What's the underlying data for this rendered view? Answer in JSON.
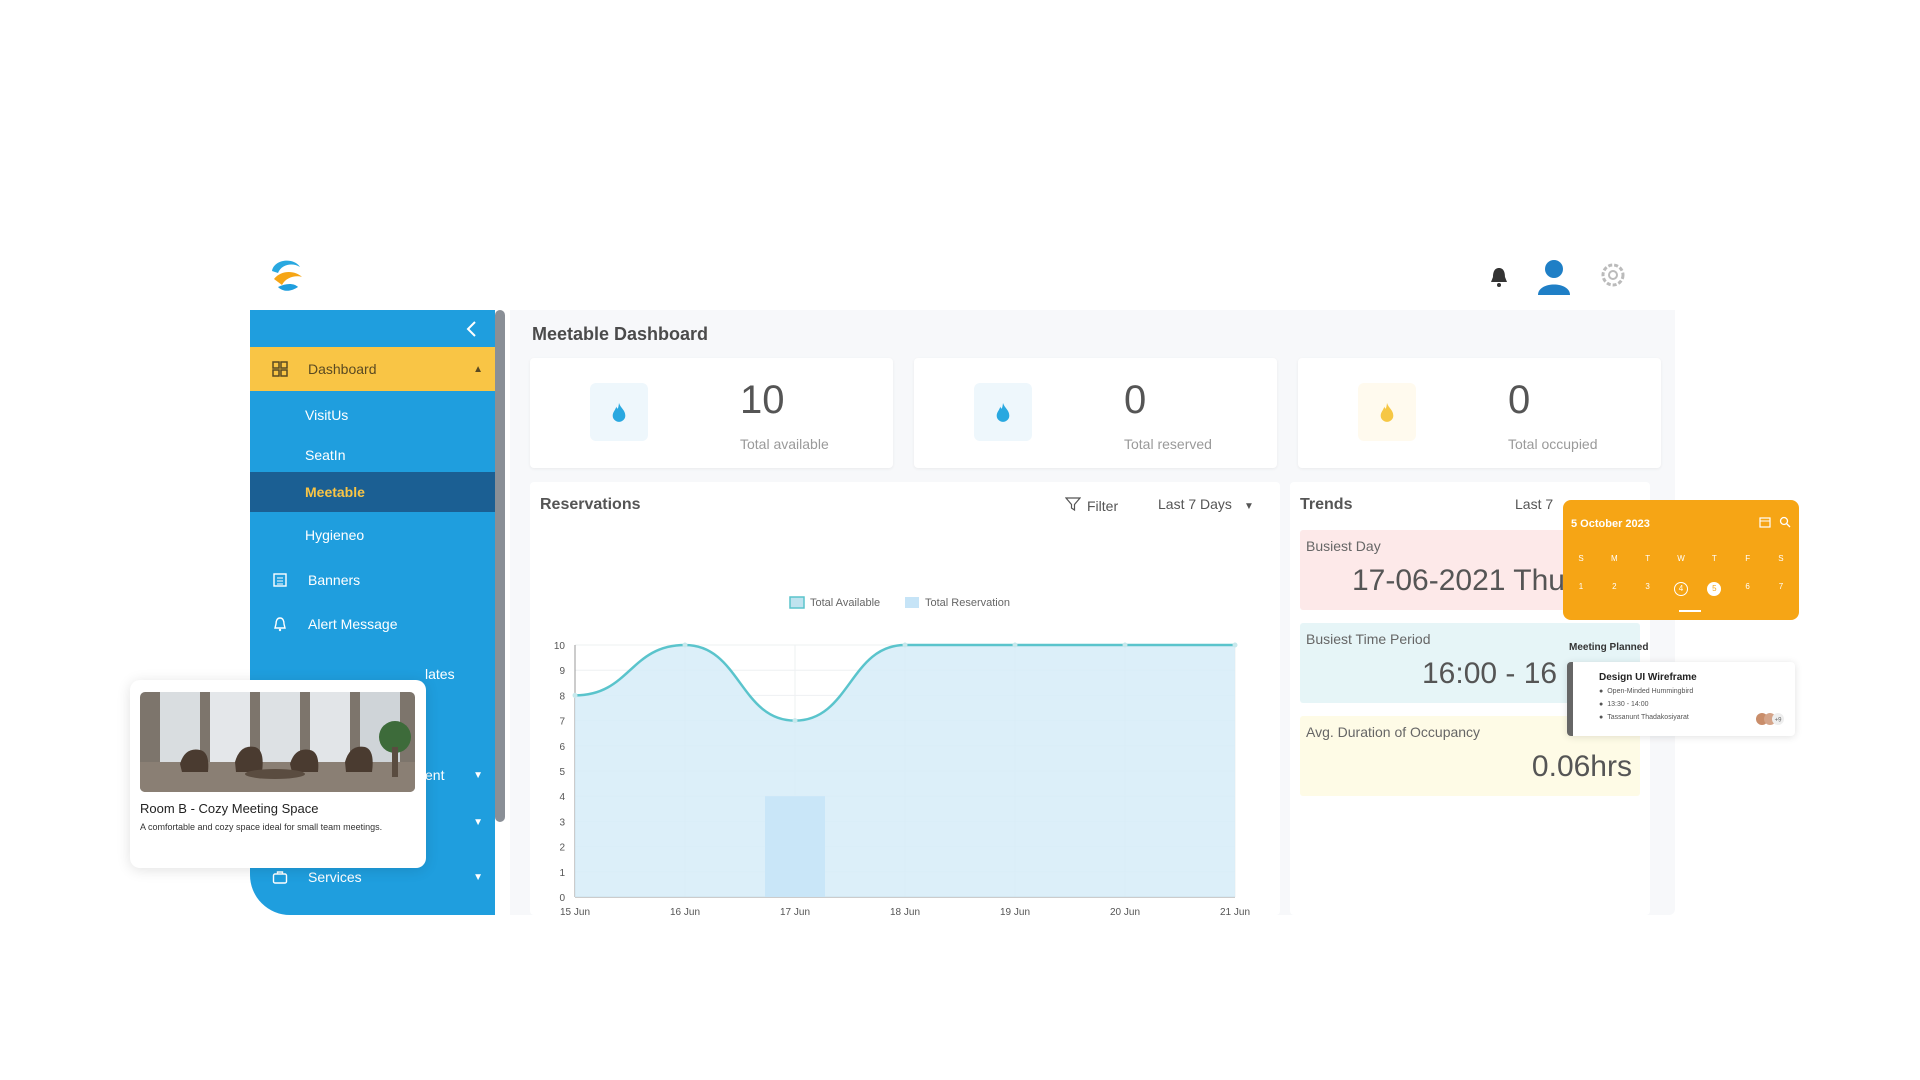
{
  "header": {
    "logo_icon": "brand-logo",
    "icons": [
      "bell-icon",
      "user-icon",
      "settings-icon"
    ]
  },
  "sidebar": {
    "collapse_icon": "chevron-left-icon",
    "dashboard": {
      "label": "Dashboard",
      "icon": "grid-icon"
    },
    "sub_items": [
      "VisitUs",
      "SeatIn",
      "Meetable",
      "Hygieneo"
    ],
    "current": "Meetable",
    "items": [
      {
        "label": "Banners",
        "icon": "list-icon"
      },
      {
        "label": "Alert Message",
        "icon": "bell-icon"
      },
      {
        "label": "lates"
      },
      {
        "label": "ent"
      },
      {
        "label": "Services",
        "icon": "briefcase-icon"
      }
    ]
  },
  "main": {
    "title": "Meetable Dashboard",
    "stats": [
      {
        "value": "10",
        "label": "Total available",
        "color": "#29a8e0"
      },
      {
        "value": "0",
        "label": "Total reserved",
        "color": "#29a8e0"
      },
      {
        "value": "0",
        "label": "Total occupied",
        "color": "#f6c744"
      }
    ]
  },
  "reservations": {
    "title": "Reservations",
    "filter_label": "Filter",
    "range_label": "Last 7 Days"
  },
  "chart_data": {
    "type": "line",
    "categories": [
      "15 Jun",
      "16 Jun",
      "17 Jun",
      "18 Jun",
      "19 Jun",
      "20 Jun",
      "21 Jun"
    ],
    "series": [
      {
        "name": "Total Available",
        "type": "area-line",
        "values": [
          8,
          10,
          7,
          10,
          10,
          10,
          10
        ],
        "color": "#5ac4cc"
      },
      {
        "name": "Total Reservation",
        "type": "bar",
        "values": [
          0,
          0,
          4,
          0,
          0,
          0,
          0
        ],
        "color": "#c6e4f7"
      }
    ],
    "ylim": [
      0,
      10
    ],
    "yticks": [
      0,
      1,
      2,
      3,
      4,
      5,
      6,
      7,
      8,
      9,
      10
    ],
    "legend_position": "top-center",
    "grid": true
  },
  "trends": {
    "title": "Trends",
    "range_label": "Last 7",
    "items": [
      {
        "label": "Busiest Day",
        "value": "17-06-2021 Thu",
        "color": "#fde9e9"
      },
      {
        "label": "Busiest Time Period",
        "value": "16:00 - 16",
        "color": "#e6f5f7"
      },
      {
        "label": "Avg. Duration of Occupancy",
        "value": "0.06hrs",
        "color": "#fefbe6"
      }
    ]
  },
  "room_card": {
    "title": "Room B - Cozy Meeting Space",
    "description": "A comfortable and cozy space ideal for small team meetings."
  },
  "calendar_widget": {
    "date_label": "5 October 2023",
    "days": [
      "S",
      "M",
      "T",
      "W",
      "T",
      "F",
      "S"
    ],
    "dates": [
      "1",
      "2",
      "3",
      "4",
      "5",
      "6",
      "7"
    ],
    "selected": "5",
    "marked": "4",
    "color": "#f6a515"
  },
  "meeting": {
    "section_title": "Meeting Planned",
    "name": "Design UI Wireframe",
    "room": "Open-Minded Hummingbird",
    "time": "13:30 - 14:00",
    "host": "Tassanunt Thadakosiyarat",
    "avatar_extra": "+9"
  }
}
